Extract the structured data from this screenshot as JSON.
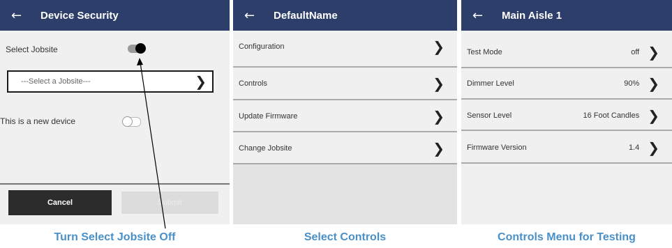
{
  "screen1": {
    "title": "Device Security",
    "back_icon": "arrow-left-icon",
    "select_jobsite_label": "Select Jobsite",
    "select_jobsite_toggle": "on",
    "dropdown_placeholder": "---Select a Jobsite---",
    "new_device_label": "This is a new device",
    "new_device_toggle": "off",
    "cancel_label": "Cancel",
    "submit_label": "Submit"
  },
  "screen2": {
    "title": "DefaultName",
    "items": [
      {
        "label": "Configuration"
      },
      {
        "label": "Controls"
      },
      {
        "label": "Update Firmware"
      },
      {
        "label": "Change Jobsite"
      }
    ]
  },
  "screen3": {
    "title": "Main Aisle 1",
    "items": [
      {
        "label": "Test Mode",
        "value": "off"
      },
      {
        "label": "Dimmer Level",
        "value": "90%"
      },
      {
        "label": "Sensor Level",
        "value": "16 Foot Candles"
      },
      {
        "label": "Firmware Version",
        "value": "1.4"
      }
    ]
  },
  "captions": {
    "c1": "Turn Select Jobsite Off",
    "c2": "Select Controls",
    "c3": "Controls Menu for Testing"
  },
  "colors": {
    "topbar": "#2d3e6b",
    "caption": "#4a90c8",
    "cancel_button": "#2c2c2c"
  }
}
